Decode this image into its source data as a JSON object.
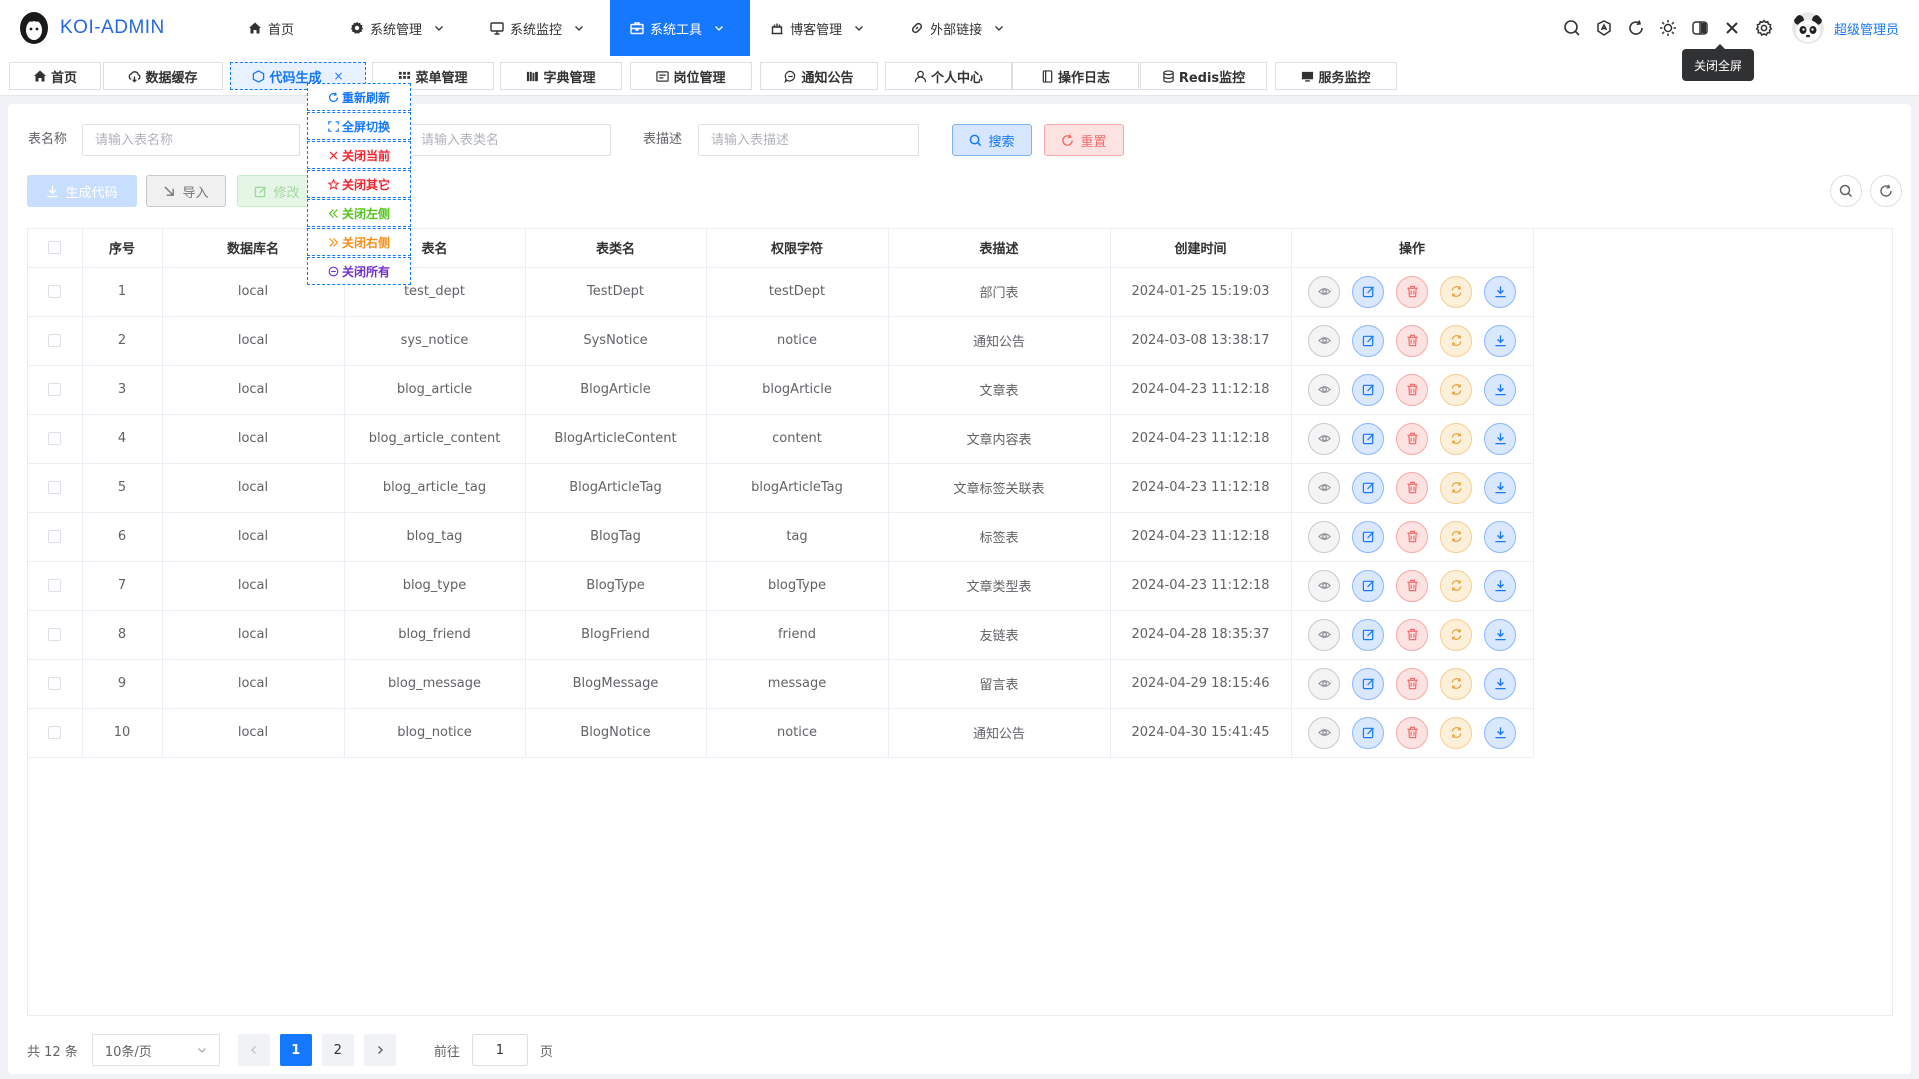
{
  "app": {
    "title": "KOI-ADMIN"
  },
  "colors": {
    "primary": "#1677ff",
    "danger": "#f56c6c",
    "warning": "#e6a23c",
    "success": "#67c23a"
  },
  "nav": [
    {
      "label": "首页",
      "icon": "home-icon",
      "dropdown": false,
      "active": false
    },
    {
      "label": "系统管理",
      "icon": "gear-icon",
      "dropdown": true,
      "active": false
    },
    {
      "label": "系统监控",
      "icon": "monitor-icon",
      "dropdown": true,
      "active": false
    },
    {
      "label": "系统工具",
      "icon": "toolbox-icon",
      "dropdown": true,
      "active": true
    },
    {
      "label": "博客管理",
      "icon": "blog-icon",
      "dropdown": true,
      "active": false
    },
    {
      "label": "外部链接",
      "icon": "link-icon",
      "dropdown": true,
      "active": false
    }
  ],
  "header": {
    "tools": [
      "search-icon",
      "translate-icon",
      "refresh-icon",
      "sun-icon",
      "layout-icon",
      "close-fullscreen-icon",
      "settings-icon"
    ],
    "username": "超级管理员",
    "tooltip": "关闭全屏"
  },
  "tabs": [
    {
      "label": "首页",
      "icon": "home-icon",
      "active": false
    },
    {
      "label": "数据缓存",
      "icon": "cache-icon",
      "active": false
    },
    {
      "label": "代码生成",
      "icon": "code-icon",
      "active": true,
      "close": "×"
    },
    {
      "label": "菜单管理",
      "icon": "menu-icon",
      "active": false
    },
    {
      "label": "字典管理",
      "icon": "dict-icon",
      "active": false
    },
    {
      "label": "岗位管理",
      "icon": "post-icon",
      "active": false
    },
    {
      "label": "通知公告",
      "icon": "notice-icon",
      "active": false
    },
    {
      "label": "个人中心",
      "icon": "user-icon",
      "active": false
    },
    {
      "label": "操作日志",
      "icon": "log-icon",
      "active": false
    },
    {
      "label": "Redis监控",
      "icon": "database-icon",
      "active": false
    },
    {
      "label": "服务监控",
      "icon": "server-icon",
      "active": false
    }
  ],
  "context_menu": [
    {
      "label": "重新刷新",
      "icon": "refresh-icon",
      "color": "#1677ff"
    },
    {
      "label": "全屏切换",
      "icon": "fullscreen-icon",
      "color": "#1677ff"
    },
    {
      "label": "关闭当前",
      "icon": "close-icon",
      "color": "#f5222d"
    },
    {
      "label": "关闭其它",
      "icon": "star-icon",
      "color": "#f5222d"
    },
    {
      "label": "关闭左侧",
      "icon": "double-left-icon",
      "color": "#52c41a"
    },
    {
      "label": "关闭右侧",
      "icon": "double-right-icon",
      "color": "#fa8c16"
    },
    {
      "label": "关闭所有",
      "icon": "minus-circle-icon",
      "color": "#722ed1"
    }
  ],
  "search": {
    "table_name_label": "表名称",
    "table_name_placeholder": "请输入表名称",
    "class_name_placeholder": "请输入表类名",
    "table_desc_label": "表描述",
    "table_desc_placeholder": "请输入表描述",
    "search_btn": "搜索",
    "reset_btn": "重置"
  },
  "toolbar": {
    "generate_btn": "生成代码",
    "import_btn": "导入",
    "edit_btn": "修改"
  },
  "table": {
    "headers": [
      "序号",
      "数据库名",
      "表名",
      "表类名",
      "权限字符",
      "表描述",
      "创建时间",
      "操作"
    ],
    "rows": [
      [
        "1",
        "local",
        "test_dept",
        "TestDept",
        "testDept",
        "部门表",
        "2024-01-25 15:19:03"
      ],
      [
        "2",
        "local",
        "sys_notice",
        "SysNotice",
        "notice",
        "通知公告",
        "2024-03-08 13:38:17"
      ],
      [
        "3",
        "local",
        "blog_article",
        "BlogArticle",
        "blogArticle",
        "文章表",
        "2024-04-23 11:12:18"
      ],
      [
        "4",
        "local",
        "blog_article_content",
        "BlogArticleContent",
        "content",
        "文章内容表",
        "2024-04-23 11:12:18"
      ],
      [
        "5",
        "local",
        "blog_article_tag",
        "BlogArticleTag",
        "blogArticleTag",
        "文章标签关联表",
        "2024-04-23 11:12:18"
      ],
      [
        "6",
        "local",
        "blog_tag",
        "BlogTag",
        "tag",
        "标签表",
        "2024-04-23 11:12:18"
      ],
      [
        "7",
        "local",
        "blog_type",
        "BlogType",
        "blogType",
        "文章类型表",
        "2024-04-23 11:12:18"
      ],
      [
        "8",
        "local",
        "blog_friend",
        "BlogFriend",
        "friend",
        "友链表",
        "2024-04-28 18:35:37"
      ],
      [
        "9",
        "local",
        "blog_message",
        "BlogMessage",
        "message",
        "留言表",
        "2024-04-29 18:15:46"
      ],
      [
        "10",
        "local",
        "blog_notice",
        "BlogNotice",
        "notice",
        "通知公告",
        "2024-04-30 15:41:45"
      ]
    ],
    "row_actions": [
      "eye-icon",
      "edit-icon",
      "delete-icon",
      "sync-icon",
      "download-icon"
    ]
  },
  "pagination": {
    "total_text": "共 12 条",
    "page_size": "10条/页",
    "pages": [
      "1",
      "2"
    ],
    "current": "1",
    "goto_label": "前往",
    "goto_value": "1",
    "page_suffix": "页"
  }
}
